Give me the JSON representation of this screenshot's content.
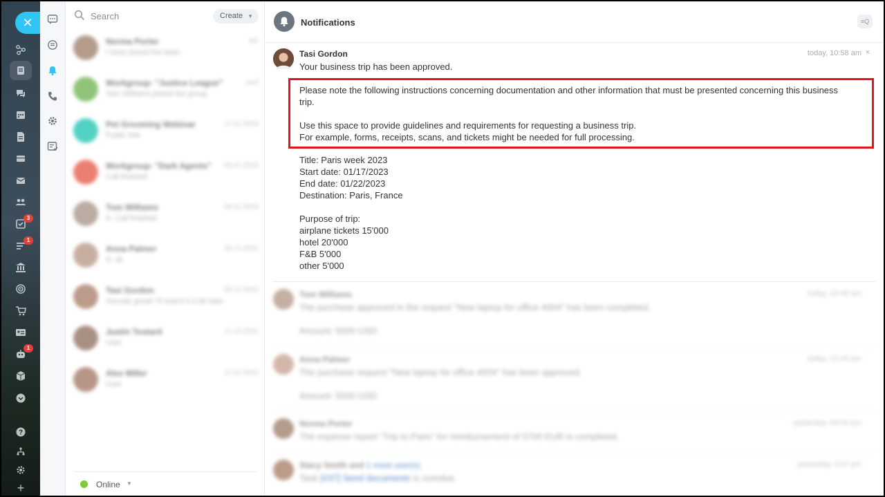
{
  "rail": {
    "badges": {
      "tasks": "3",
      "feed": "1",
      "robot": "1"
    }
  },
  "chat_list": {
    "search_placeholder": "Search",
    "create_label": "Create",
    "items": [
      {
        "name": "Norma Porter",
        "subtitle": "I have joined the team",
        "date": "Mo",
        "avatar_color": "#9b7a66"
      },
      {
        "name": "Workgroup: \"Justice League\"",
        "subtitle": "Tom Williams joined the group",
        "date": "wed",
        "avatar_color": "#6ab04c"
      },
      {
        "name": "Pet Grooming Webinar",
        "subtitle": "Public link",
        "date": "17.01.2023",
        "avatar_color": "#19c3b0"
      },
      {
        "name": "Workgroup: \"Dark Agents\"",
        "subtitle": "Call finished",
        "date": "05.01.2023",
        "avatar_color": "#e55643"
      },
      {
        "name": "Tom Williams",
        "subtitle": "A: Call finished",
        "date": "08.01.2023",
        "avatar_color": "#a58f84"
      },
      {
        "name": "Anna Palmer",
        "subtitle": "A: ok",
        "date": "30.12.2022",
        "avatar_color": "#b69482"
      },
      {
        "name": "Tasi Gordon",
        "subtitle": "Sounds great! I'll watch it a bit later",
        "date": "05.12.2022",
        "avatar_color": "#a57b63"
      },
      {
        "name": "Justin Testard",
        "subtitle": "User",
        "date": "11.10.2022",
        "avatar_color": "#8c6b59"
      },
      {
        "name": "Alex Miller",
        "subtitle": "User",
        "date": "11.10.2022",
        "avatar_color": "#a0735e"
      }
    ],
    "status_label": "Online"
  },
  "notifications": {
    "title": "Notifications",
    "search_label": "≡Q",
    "main": {
      "author": "Tasi Gordon",
      "time": "today, 10:58 am",
      "close": "×",
      "message": "Your business trip has been approved.",
      "instructions_1": "Please note the following instructions concerning documentation and other information that must be presented concerning this business",
      "instructions_2": "trip.",
      "instructions_3": "Use this space to provide guidelines and requirements for requesting a business trip.",
      "instructions_4": "For example, forms, receipts, scans, and tickets might be needed for full processing.",
      "title_line": "Title: Paris week 2023",
      "start_line": "Start date: 01/17/2023",
      "end_line": "End date: 01/22/2023",
      "destination_line": "Destination: Paris, France",
      "purpose_label": "Purpose of trip:",
      "purpose_1": "airplane tickets 15'000",
      "purpose_2": "hotel 20'000",
      "purpose_3": "F&B 5'000",
      "purpose_4": "other 5'000"
    },
    "others": [
      {
        "author": "Tom Williams",
        "time": "today, 10:48 am",
        "line1": "The purchase approved in the request \"New laptop for office 4004\" has been completed.",
        "line2": "Amount: 5000 USD"
      },
      {
        "author": "Anna Palmer",
        "time": "today, 10:44 am",
        "line1": "The purchase request \"New laptop for office 4004\" has been approved.",
        "line2": "Amount: 5000 USD"
      },
      {
        "author": "Norma Porter",
        "time": "yesterday, 04:00 pm",
        "line1": "The expense report \"Trip to Paris\" for reimbursement of 5700 EUR is completed.",
        "line2": ""
      },
      {
        "author": "Stacy Smith and",
        "author_link": "1 more user(s)",
        "time": "yesterday, 3:07 pm",
        "line1_prefix": "Task",
        "line1_link": "[#37] Send documents",
        "line1_suffix": "is overdue.",
        "line2": ""
      }
    ]
  }
}
